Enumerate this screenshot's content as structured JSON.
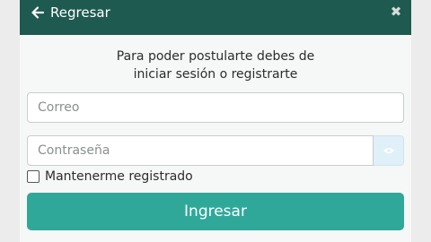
{
  "header": {
    "back_label": "Regresar",
    "close_glyph": "✖",
    "back_icon": "arrow-left-icon",
    "close_icon": "close-icon",
    "bg_color": "#1f5a50"
  },
  "prompt": {
    "line1": "Para poder postularte debes de",
    "line2": "iniciar sesión o registrarte"
  },
  "form": {
    "email_placeholder": "Correo",
    "email_value": "",
    "password_placeholder": "Contraseña",
    "password_value": "",
    "eye_icon": "eye-icon",
    "remember_label": "Mantenerme registrado",
    "remember_checked": false,
    "submit_label": "Ingresar",
    "submit_color": "#2fa89a"
  }
}
